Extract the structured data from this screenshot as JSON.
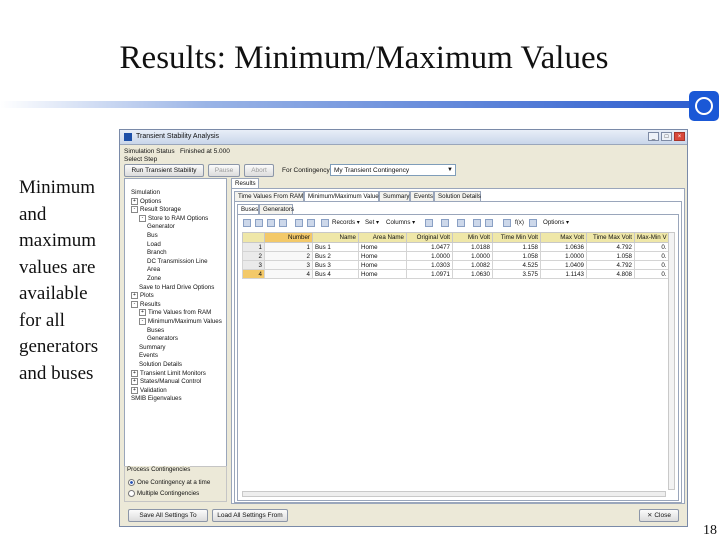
{
  "slide": {
    "title": "Results: Minimum/Maximum Values",
    "side_lines": [
      "Minimum",
      "and",
      "maximum",
      "values are",
      "available",
      "for all",
      "generators",
      "and buses"
    ],
    "page_number": "18"
  },
  "window": {
    "title": "Transient Stability Analysis",
    "buttons": {
      "minimize": "_",
      "maximize": "□",
      "close": "×"
    },
    "status_label": "Simulation Status",
    "status_value": "Finished at 5.000",
    "select_step": "Select Step",
    "run_button": "Run Transient Stability",
    "pause_button": "Pause",
    "abort_button": "Abort",
    "contingency_label": "For Contingency:",
    "contingency_value": "My Transient Contingency"
  },
  "tree": [
    {
      "label": "Simulation",
      "indent": 0,
      "pm": ""
    },
    {
      "label": "Options",
      "indent": 0,
      "pm": "+"
    },
    {
      "label": "Result Storage",
      "indent": 0,
      "pm": "-"
    },
    {
      "label": "Store to RAM Options",
      "indent": 1,
      "pm": "-"
    },
    {
      "label": "Generator",
      "indent": 2,
      "pm": ""
    },
    {
      "label": "Bus",
      "indent": 2,
      "pm": ""
    },
    {
      "label": "Load",
      "indent": 2,
      "pm": ""
    },
    {
      "label": "Branch",
      "indent": 2,
      "pm": ""
    },
    {
      "label": "DC Transmission Line",
      "indent": 2,
      "pm": ""
    },
    {
      "label": "Area",
      "indent": 2,
      "pm": ""
    },
    {
      "label": "Zone",
      "indent": 2,
      "pm": ""
    },
    {
      "label": "Save to Hard Drive Options",
      "indent": 1,
      "pm": ""
    },
    {
      "label": "Plots",
      "indent": 0,
      "pm": "+"
    },
    {
      "label": "Results",
      "indent": 0,
      "pm": "-"
    },
    {
      "label": "Time Values from RAM",
      "indent": 1,
      "pm": "+"
    },
    {
      "label": "Minimum/Maximum Values",
      "indent": 1,
      "pm": "-"
    },
    {
      "label": "Buses",
      "indent": 2,
      "pm": ""
    },
    {
      "label": "Generators",
      "indent": 2,
      "pm": ""
    },
    {
      "label": "Summary",
      "indent": 1,
      "pm": ""
    },
    {
      "label": "Events",
      "indent": 1,
      "pm": ""
    },
    {
      "label": "Solution Details",
      "indent": 1,
      "pm": ""
    },
    {
      "label": "Transient Limit Monitors",
      "indent": 0,
      "pm": "+"
    },
    {
      "label": "States/Manual Control",
      "indent": 0,
      "pm": "+"
    },
    {
      "label": "Validation",
      "indent": 0,
      "pm": "+"
    },
    {
      "label": "SMIB Eigenvalues",
      "indent": 0,
      "pm": ""
    }
  ],
  "process": {
    "label": "Process Contingencies",
    "one": "One Contingency at a time",
    "multiple": "Multiple Contingencies"
  },
  "results_tab": "Results",
  "subtabs": [
    "Time Values From RAM",
    "Minimum/Maximum Values",
    "Summary",
    "Events",
    "Solution Details"
  ],
  "inner_tabs": [
    "Buses",
    "Generators"
  ],
  "grid_toolbar": {
    "records": "Records ▾",
    "set": "Set ▾",
    "columns": "Columns ▾",
    "fx": "f(x)",
    "options": "Options ▾"
  },
  "table": {
    "headers": [
      "Number",
      "Name",
      "Area Name",
      "Original Volt",
      "Min Volt",
      "Time Min Volt",
      "Max Volt",
      "Time Max Volt",
      "Max-Min V"
    ],
    "rows": [
      [
        "1",
        "1",
        "Bus 1",
        "Home",
        "1.0477",
        "1.0188",
        "1.158",
        "1.0636",
        "4.792",
        "0."
      ],
      [
        "2",
        "2",
        "Bus 2",
        "Home",
        "1.0000",
        "1.0000",
        "1.058",
        "1.0000",
        "1.058",
        "0."
      ],
      [
        "3",
        "3",
        "Bus 3",
        "Home",
        "1.0303",
        "1.0082",
        "4.525",
        "1.0409",
        "4.792",
        "0."
      ],
      [
        "4",
        "4",
        "Bus 4",
        "Home",
        "1.0971",
        "1.0630",
        "3.575",
        "1.1143",
        "4.808",
        "0."
      ]
    ]
  },
  "footer": {
    "save": "Save All Settings To",
    "load": "Load All Settings From",
    "close": "Close"
  },
  "colors": {
    "title_rule": "#2f5fcf",
    "logo": "#1a58d6",
    "header_row": "#efe7a8",
    "selected_header": "#f3c969"
  }
}
